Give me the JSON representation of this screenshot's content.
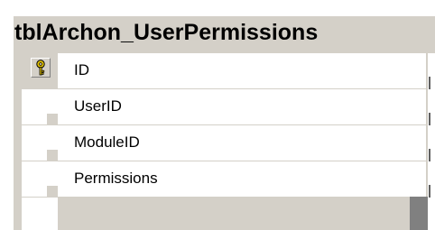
{
  "table": {
    "title": "tblArchon_UserPermissions",
    "columns": [
      {
        "name": "ID",
        "primary_key": true
      },
      {
        "name": "UserID",
        "primary_key": false
      },
      {
        "name": "ModuleID",
        "primary_key": false
      },
      {
        "name": "Permissions",
        "primary_key": false
      }
    ]
  },
  "icons": {
    "primary_key": "key-icon"
  },
  "colors": {
    "frame": "#d4d0c8",
    "key_gold": "#e0c000",
    "row_background": "#ffffff",
    "scroll_thumb": "#808080"
  }
}
